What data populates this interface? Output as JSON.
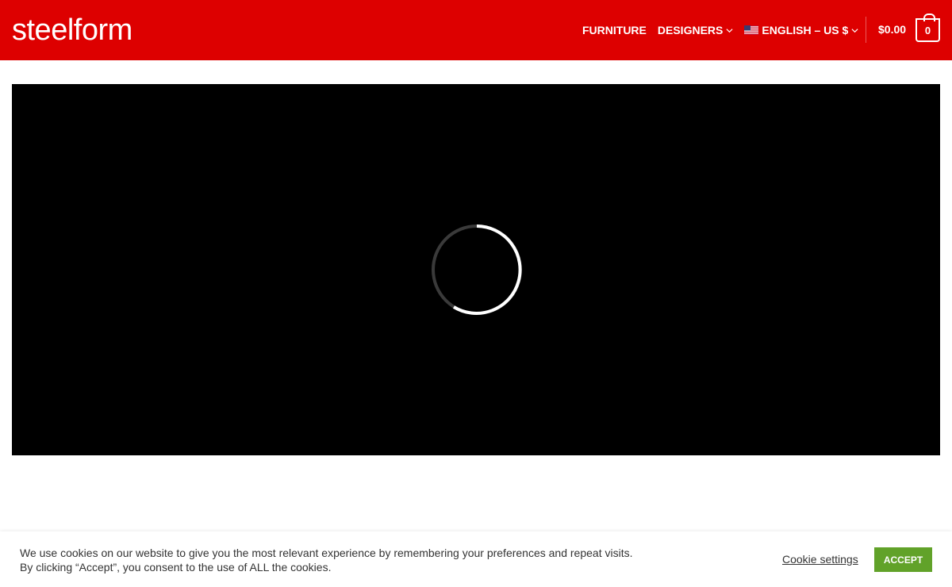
{
  "header": {
    "logo_text": "steelform",
    "nav": [
      {
        "label": "FURNITURE",
        "has_dropdown": false
      },
      {
        "label": "DESIGNERS",
        "has_dropdown": true
      },
      {
        "label": "ENGLISH – US $",
        "has_dropdown": true,
        "icon": "us-flag-icon"
      }
    ],
    "cart_total": "$0.00",
    "cart_count": "0"
  },
  "video": {
    "state": "loading",
    "spinner_icon": "loading-spinner-icon"
  },
  "cookie_banner": {
    "line1": "We use cookies on our website to give you the most relevant experience by remembering your preferences and repeat visits.",
    "line2": "By clicking “Accept”, you consent to the use of ALL the cookies.",
    "settings_label": "Cookie settings",
    "accept_label": "ACCEPT"
  },
  "colors": {
    "brand_red": "#dd0000",
    "accept_green": "#61a229",
    "video_bg": "#000000"
  }
}
